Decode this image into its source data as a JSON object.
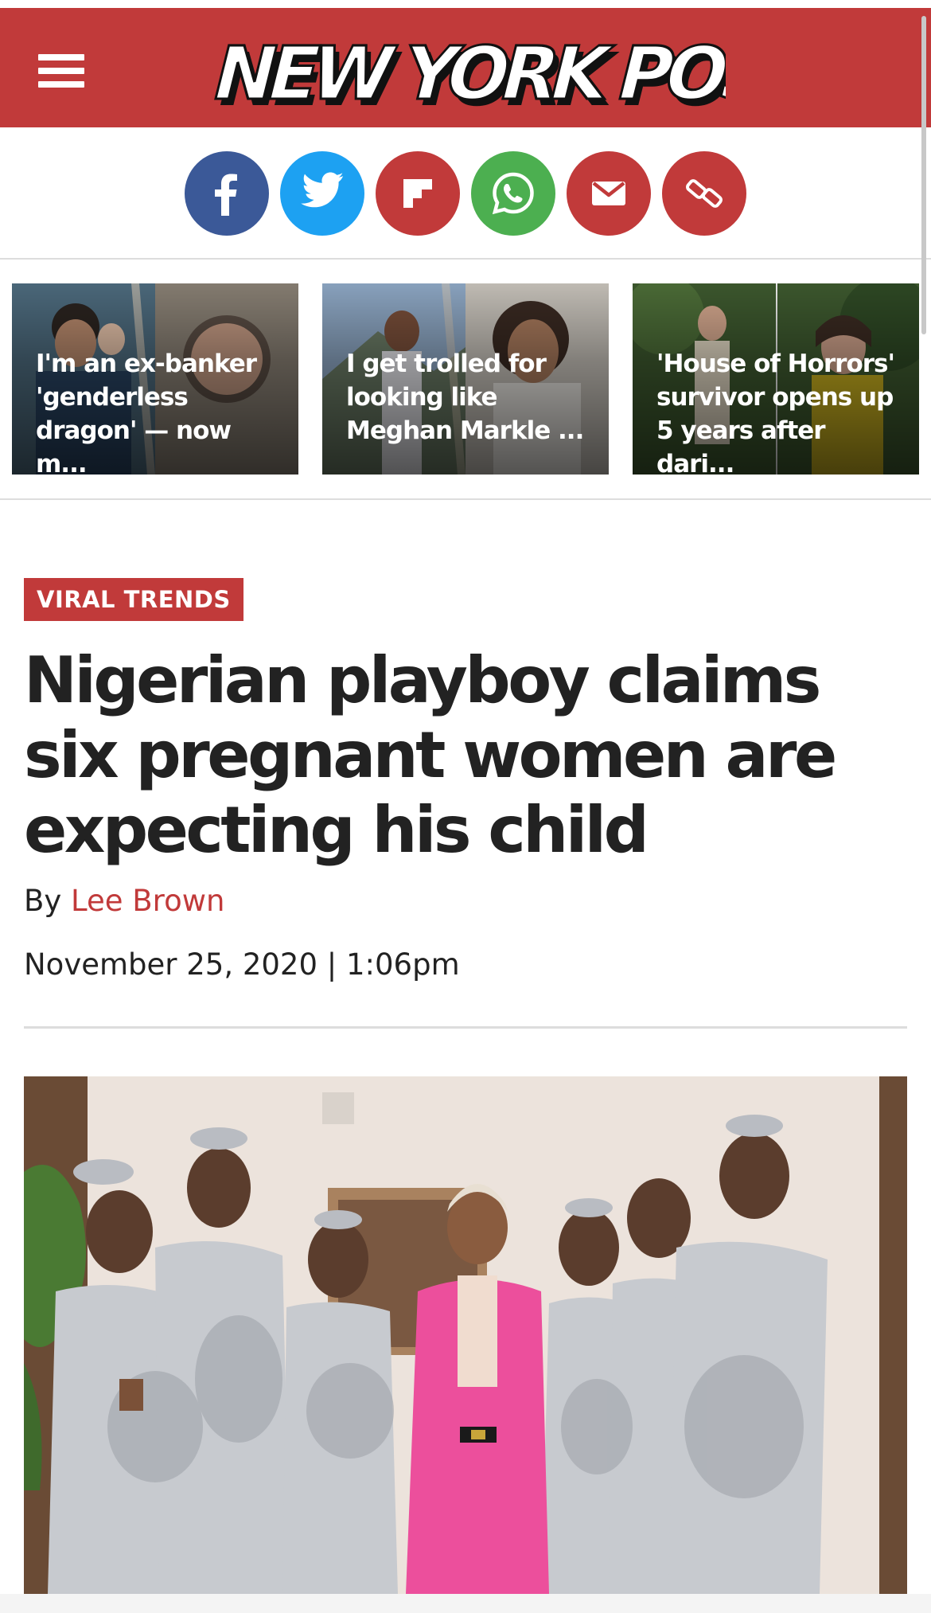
{
  "header": {
    "logo_text": "NEW YORK POST",
    "menu_icon": "hamburger-menu-icon",
    "brand_color": "#c13a3a"
  },
  "share": [
    {
      "name": "facebook",
      "icon": "facebook-icon",
      "color": "#3b5998"
    },
    {
      "name": "twitter",
      "icon": "twitter-icon",
      "color": "#1da1f2"
    },
    {
      "name": "flipboard",
      "icon": "flipboard-icon",
      "color": "#c13a3a"
    },
    {
      "name": "whatsapp",
      "icon": "whatsapp-icon",
      "color": "#4caf50"
    },
    {
      "name": "email",
      "icon": "email-icon",
      "color": "#c13a3a"
    },
    {
      "name": "copy-link",
      "icon": "link-icon",
      "color": "#c13a3a"
    }
  ],
  "trending": [
    {
      "title": "I'm an ex-banker 'genderless dragon' — now m..."
    },
    {
      "title": "I get trolled for looking like Meghan Markle ..."
    },
    {
      "title": "'House of Horrors' survivor opens up 5 years after dari..."
    }
  ],
  "article": {
    "category": "VIRAL TRENDS",
    "headline": "Nigerian playboy claims six pregnant women are expecting his child",
    "by_prefix": "By",
    "author": "Lee Brown",
    "date": "November 25, 2020 | 1:06pm"
  }
}
